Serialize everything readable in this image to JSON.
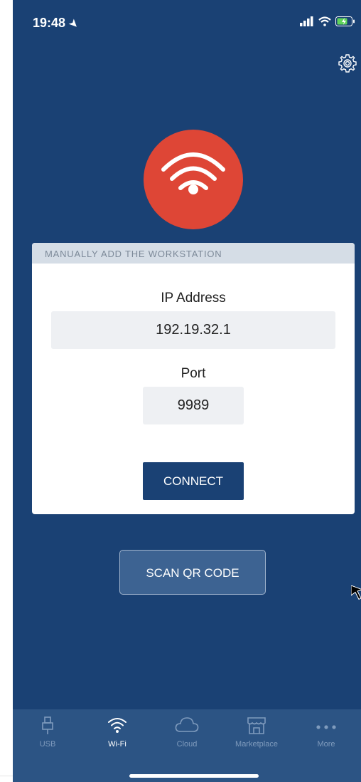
{
  "status_bar": {
    "time": "19:48"
  },
  "manual_card": {
    "header": "MANUALLY ADD THE WORKSTATION",
    "ip_label": "IP Address",
    "ip_value": "192.19.32.1",
    "port_label": "Port",
    "port_value": "9989",
    "connect_label": "CONNECT"
  },
  "scan_qr_label": "SCAN QR CODE",
  "tabs": [
    {
      "label": "USB",
      "icon": "usb-icon",
      "active": false
    },
    {
      "label": "Wi-Fi",
      "icon": "wifi-icon",
      "active": true
    },
    {
      "label": "Cloud",
      "icon": "cloud-icon",
      "active": false
    },
    {
      "label": "Marketplace",
      "icon": "store-icon",
      "active": false
    },
    {
      "label": "More",
      "icon": "more-icon",
      "active": false
    }
  ],
  "colors": {
    "background": "#1a4174",
    "accent_red": "#de4636",
    "tabbar": "#2c5484"
  }
}
